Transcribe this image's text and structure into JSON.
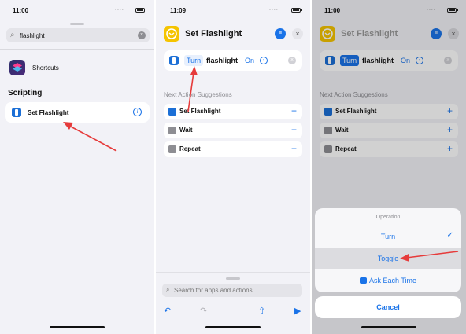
{
  "panel1": {
    "status_time": "11:00",
    "status_dots": "....",
    "search": {
      "value": "flashlight",
      "clear_icon": "clear-icon"
    },
    "app_result": {
      "label": "Shortcuts",
      "icon": "shortcuts-app-icon"
    },
    "section_title": "Scripting",
    "action_result": {
      "label": "Set Flashlight",
      "icon": "flashlight-icon",
      "info_glyph": "i"
    }
  },
  "panel2": {
    "status_time": "11:09",
    "status_dots": "....",
    "title": "Set Flashlight",
    "action": {
      "token1": "Turn",
      "word": "flashlight",
      "token2": "On"
    },
    "suggestions_header": "Next Action Suggestions",
    "suggestions": [
      {
        "label": "Set Flashlight",
        "icon": "flashlight-icon"
      },
      {
        "label": "Wait",
        "icon": "timer-icon"
      },
      {
        "label": "Repeat",
        "icon": "repeat-icon"
      }
    ],
    "search_placeholder": "Search for apps and actions",
    "toolbar": [
      "undo-icon",
      "redo-icon",
      "share-icon",
      "play-icon"
    ]
  },
  "panel3": {
    "status_time": "11:00",
    "status_dots": "....",
    "title": "Set Flashlight",
    "action": {
      "token1": "Turn",
      "word": "flashlight",
      "token2": "On"
    },
    "suggestions_header": "Next Action Suggestions",
    "suggestions": [
      {
        "label": "Set Flashlight"
      },
      {
        "label": "Wait"
      },
      {
        "label": "Repeat"
      }
    ],
    "operation_sheet": {
      "header": "Operation",
      "options": [
        {
          "label": "Turn",
          "selected": true
        },
        {
          "label": "Toggle",
          "highlighted": true
        },
        {
          "label": "Ask Each Time"
        }
      ],
      "cancel_label": "Cancel"
    }
  },
  "colors": {
    "accent": "#1a73e8",
    "shortcut_tile": "#f5c400",
    "annotation_arrow": "#e63b3b",
    "background": "#f2f2f7"
  }
}
